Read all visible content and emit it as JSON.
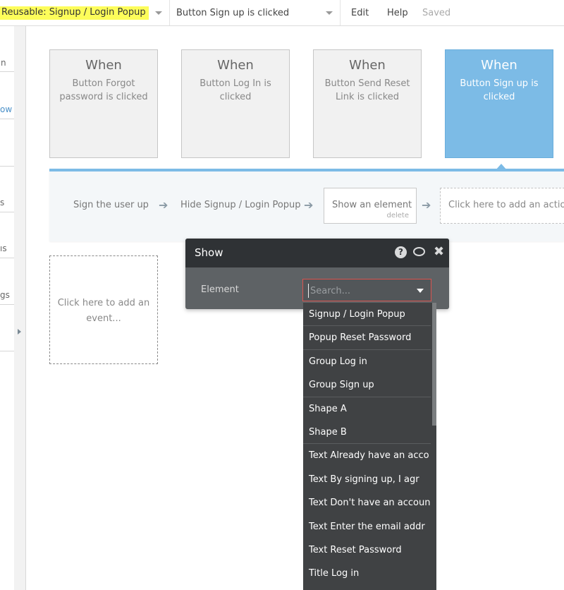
{
  "topbar": {
    "page_selector": "Reusable: Signup / Login Popup",
    "event_selector": "Button Sign up is clicked",
    "menu": [
      "Edit",
      "Help"
    ],
    "status": "Saved"
  },
  "sidebar": {
    "fragments": [
      "n",
      "ow",
      "s",
      "ıs",
      "gs"
    ]
  },
  "events": [
    {
      "when": "When",
      "desc": "Button Forgot password is clicked"
    },
    {
      "when": "When",
      "desc": "Button Log In is clicked"
    },
    {
      "when": "When",
      "desc": "Button Send Reset Link is clicked"
    },
    {
      "when": "When",
      "desc": "Button Sign up is clicked"
    }
  ],
  "actions": {
    "steps": [
      "Sign the user up",
      "Hide Signup / Login Popup"
    ],
    "current": "Show an element",
    "delete_label": "delete",
    "add_action": "Click here to add an action..."
  },
  "add_event": "Click here to add an event...",
  "popup": {
    "title": "Show",
    "help_icon": "?",
    "close_icon": "✖",
    "field_label": "Element",
    "search_placeholder": "Search..."
  },
  "dropdown": {
    "items": [
      "Signup / Login Popup",
      "Popup Reset Password",
      "Group Log in",
      "Group Sign up",
      "Shape A",
      "Shape B",
      "Text Already have an acco",
      "Text By signing up, I agr",
      "Text Don't have an accoun",
      "Text Enter the email addr",
      "Text Reset Password",
      "Title Log in"
    ]
  },
  "colors": {
    "accent": "#7cbbe6",
    "highlight": "#fdfd5a",
    "popup_header": "#2f3235",
    "popup_body": "#5e6265",
    "dropdown_bg": "#404244",
    "error_border": "#d9534f"
  }
}
